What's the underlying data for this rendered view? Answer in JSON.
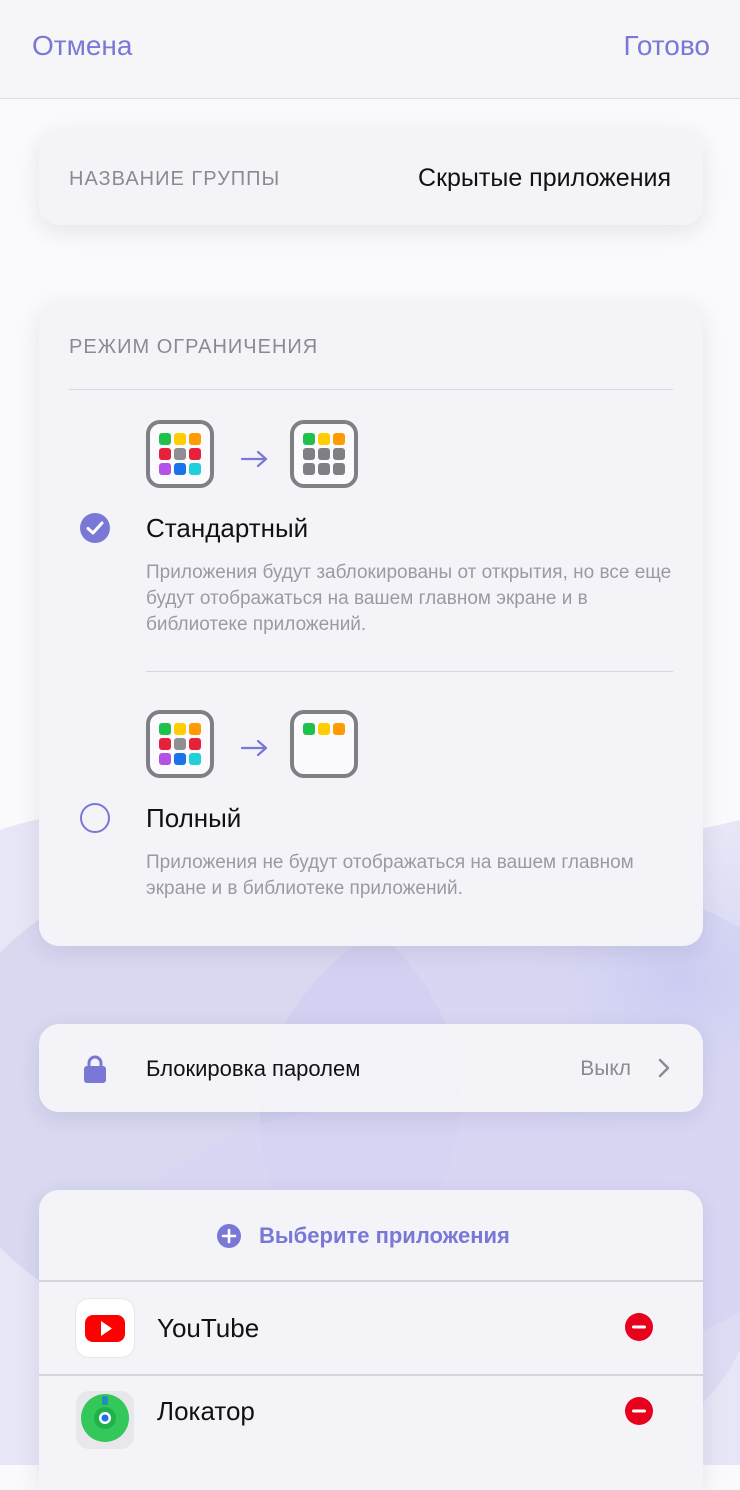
{
  "nav": {
    "cancel_label": "Отмена",
    "done_label": "Готово"
  },
  "group": {
    "label": "НАЗВАНИЕ ГРУППЫ",
    "value": "Скрытые приложения"
  },
  "mode": {
    "title": "РЕЖИМ ОГРАНИЧЕНИЯ",
    "options": [
      {
        "title": "Стандартный",
        "description": "Приложения будут заблокированы от открытия, но все еще будут отображаться на вашем главном экране и в библиотеке приложений.",
        "selected": true
      },
      {
        "title": "Полный",
        "description": "Приложения не будут отображаться на вашем главном экране и в библиотеке приложений.",
        "selected": false
      }
    ]
  },
  "passcode": {
    "label": "Блокировка паролем",
    "value": "Выкл"
  },
  "apps": {
    "choose_label": "Выберите приложения",
    "items": [
      {
        "name": "YouTube",
        "icon": "youtube-icon"
      },
      {
        "name": "Локатор",
        "icon": "find-my-icon"
      }
    ]
  },
  "colors": {
    "accent": "#7a78d6",
    "remove": "#e8001c",
    "app_dots": [
      "#1ec14a",
      "#ffcc00",
      "#ff9a00",
      "#e8213a",
      "#8e8e93",
      "#e8213a",
      "#b452e6",
      "#1a73e8",
      "#1fd0d8"
    ]
  }
}
